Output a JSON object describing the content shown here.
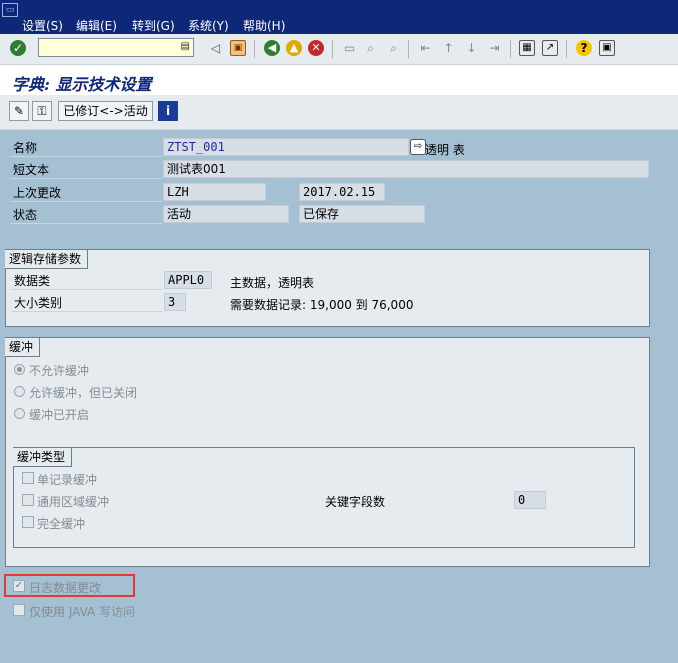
{
  "menu": [
    "设置(S)",
    "编辑(E)",
    "转到(G)",
    "系统(Y)",
    "帮助(H)"
  ],
  "page_title": "字典: 显示技术设置",
  "app_toolbar": {
    "revised_active_label": "已修订<->活动",
    "info_label": "i"
  },
  "fields": {
    "name_label": "名称",
    "name_value": "ZTST_001",
    "name_suffix": "透明 表",
    "short_text_label": "短文本",
    "short_text_value": "测试表001",
    "last_changed_label": "上次更改",
    "last_changed_user": "LZH",
    "last_changed_date": "2017.02.15",
    "status_label": "状态",
    "status_value1": "活动",
    "status_value2": "已保存"
  },
  "logical_storage": {
    "title": "逻辑存储参数",
    "data_class_label": "数据类",
    "data_class_value": "APPL0",
    "data_class_desc": "主数据，透明表",
    "size_category_label": "大小类别",
    "size_category_value": "3",
    "size_category_desc": "需要数据记录: 19,000 到 76,000"
  },
  "buffering": {
    "title": "缓冲",
    "options": [
      "不允许缓冲",
      "允许缓冲，但已关闭",
      "缓冲已开启"
    ],
    "selected": "不允许缓冲",
    "type_title": "缓冲类型",
    "type_options": [
      "单记录缓冲",
      "通用区域缓冲",
      "完全缓冲"
    ],
    "key_fields_label": "关键字段数",
    "key_fields_value": "0"
  },
  "log_data_changes": {
    "label": "日志数据更改",
    "checked": true
  },
  "java_only": {
    "label": "仅使用 JAVA 写访问",
    "checked": false
  },
  "colors": {
    "highlight": "#e53935",
    "menubar": "#0f2779",
    "background": "#a5bfd3"
  }
}
